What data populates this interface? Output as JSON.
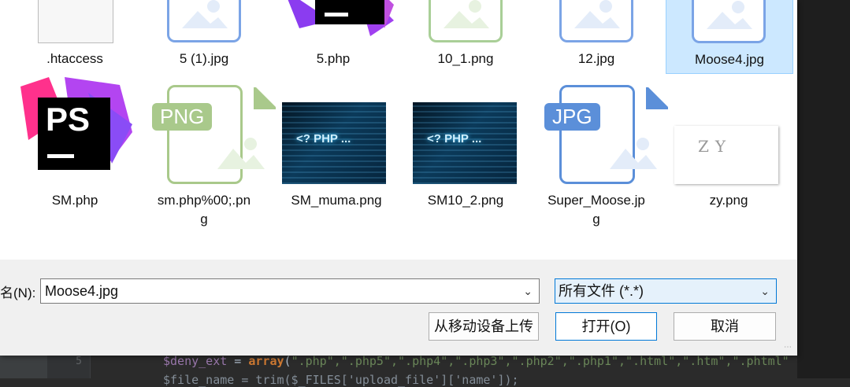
{
  "editor": {
    "line_number": "5",
    "code_line": {
      "var": "$deny_ext",
      "eq": " = ",
      "fn": "array",
      "open": "(",
      "args": "\".php\",\".php5\",\".php4\",\".php3\",\".php2\",\".php1\",\".html\",\".htm\",\".phtml\""
    },
    "code_line_2": "$file_name = trim($_FILES['upload_file']['name']);"
  },
  "files": [
    {
      "name": ".htaccess",
      "type": "blank"
    },
    {
      "name": "5 (1).jpg",
      "type": "image-blue"
    },
    {
      "name": "5.php",
      "type": "phpstorm"
    },
    {
      "name": "10_1.png",
      "type": "image-green"
    },
    {
      "name": "12.jpg",
      "type": "image-blue"
    },
    {
      "name": "Moose4.jpg",
      "type": "image-blue",
      "selected": true
    },
    {
      "name": "SM.php",
      "type": "phpstorm"
    },
    {
      "name_line1": "sm.php%00;.pn",
      "name_line2": "g",
      "type": "png-doc",
      "badge": "PNG"
    },
    {
      "name": "SM_muma.png",
      "type": "thumb-php",
      "thumb_text": "<? PHP ..."
    },
    {
      "name": "SM10_2.png",
      "type": "thumb-php",
      "thumb_text": "<? PHP ..."
    },
    {
      "name_line1": "Super_Moose.jp",
      "name_line2": "g",
      "type": "jpg-doc",
      "badge": "JPG"
    },
    {
      "name": "zy.png",
      "type": "thumb-zy",
      "thumb_text": "ZY"
    }
  ],
  "ps_badge": "PS",
  "footer": {
    "filename_label": "名(N):",
    "filename_value": "Moose4.jpg",
    "filetype_value": "所有文件 (*.*)",
    "upload_mobile_button": "从移动设备上传",
    "open_button": "打开(O)",
    "cancel_button": "取消"
  },
  "colors": {
    "selection_bg": "#cce8ff",
    "png_green": "#a9c98b",
    "jpg_blue": "#5b8fd9",
    "primary_border": "#0078d7"
  }
}
